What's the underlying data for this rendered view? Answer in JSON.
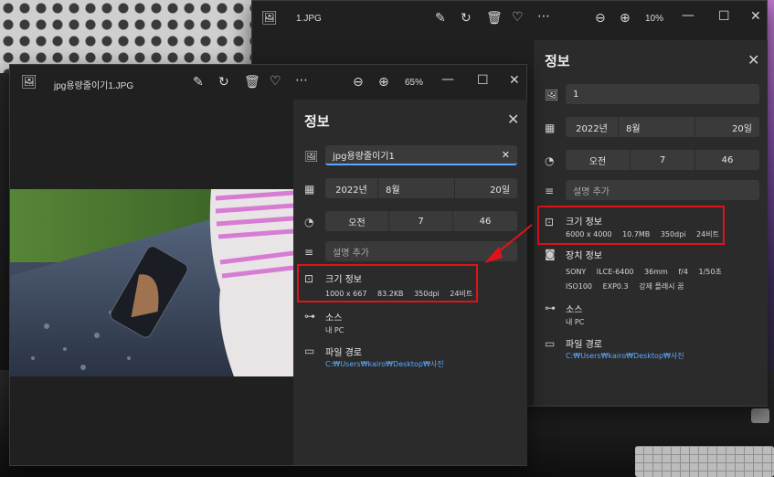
{
  "colors": {
    "accent_blue": "#5aa9ff",
    "highlight_red": "#e0131a",
    "panel_bg": "#2b2b2b",
    "field_bg": "#3a3a3a"
  },
  "back_window": {
    "title": "1.JPG",
    "zoom": "10%",
    "info": {
      "heading": "정보",
      "filename_value": "1",
      "date": {
        "year": "2022년",
        "month": "8월",
        "day": "20일"
      },
      "time": {
        "ampm": "오전",
        "hour": "7",
        "minute": "46"
      },
      "description_placeholder": "설명 추가",
      "size_info": {
        "label": "크기 정보",
        "dimensions": "6000 x 4000",
        "filesize": "10.7MB",
        "dpi": "350dpi",
        "bits": "24비트"
      },
      "camera_info": {
        "label": "장치 정보",
        "line1": [
          "SONY",
          "ILCE-6400",
          "36mm",
          "f/4",
          "1/50초"
        ],
        "line2": [
          "ISO100",
          "EXP0.3",
          "강제 플래시 꿈"
        ]
      },
      "source": {
        "label": "소스",
        "value": "내 PC"
      },
      "file_path": {
        "label": "파일 경로",
        "value": "C:₩Users₩kairo₩Desktop₩사진"
      }
    }
  },
  "front_window": {
    "title": "jpg용량줄이기1.JPG",
    "zoom": "65%",
    "info": {
      "heading": "정보",
      "filename_value": "jpg용량줄이기1",
      "date": {
        "year": "2022년",
        "month": "8월",
        "day": "20일"
      },
      "time": {
        "ampm": "오전",
        "hour": "7",
        "minute": "46"
      },
      "description_placeholder": "설명 추가",
      "size_info": {
        "label": "크기 정보",
        "dimensions": "1000 x 667",
        "filesize": "83.2KB",
        "dpi": "350dpi",
        "bits": "24비트"
      },
      "source": {
        "label": "소스",
        "value": "내 PC"
      },
      "file_path": {
        "label": "파일 경로",
        "value": "C:₩Users₩kairo₩Desktop₩사진"
      }
    }
  }
}
